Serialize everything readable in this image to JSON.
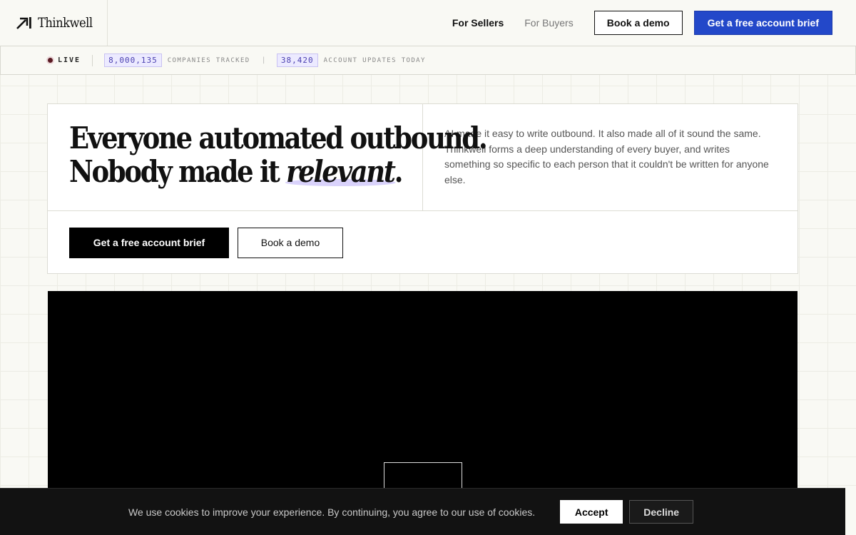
{
  "header": {
    "brand_name": "Thinkwell",
    "nav": {
      "for_sellers": "For Sellers",
      "for_buyers": "For Buyers",
      "book_demo": "Book a demo",
      "get_brief": "Get a free account brief"
    }
  },
  "ticker": {
    "live_label": "LIVE",
    "companies_count": "8,000,135",
    "companies_label": "COMPANIES TRACKED",
    "updates_count": "38,420",
    "updates_label": "ACCOUNT UPDATES TODAY"
  },
  "hero": {
    "headline_line1": "Everyone automated outbound.",
    "headline_line2_prefix": "Nobody made it ",
    "headline_emphasis": "relevant",
    "headline_line2_suffix": ".",
    "description": "AI made it easy to write outbound. It also made all of it sound the same. Thinkwell forms a deep understanding of every buyer, and writes something so specific to each person that it couldn't be written for anyone else.",
    "primary_cta": "Get a free account brief",
    "secondary_cta": "Book a demo"
  },
  "cookie_banner": {
    "message": "We use cookies to improve your experience. By continuing, you agree to our use of cookies.",
    "accept": "Accept",
    "decline": "Decline"
  },
  "colors": {
    "accent_blue": "#2348c9",
    "highlight_lavender": "#d9d2fb",
    "background": "#f9f9f4"
  }
}
